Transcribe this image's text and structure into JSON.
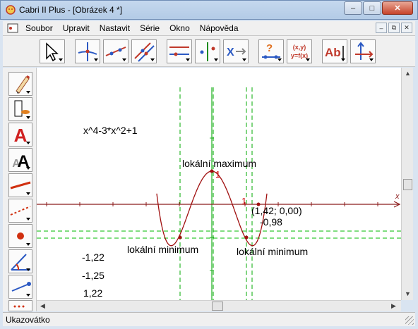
{
  "window": {
    "title": "Cabri II Plus - [Obrázek 4 *]"
  },
  "menu": [
    "Soubor",
    "Upravit",
    "Nastavit",
    "Série",
    "Okno",
    "Nápověda"
  ],
  "toolbar": {
    "tools": [
      "pointer-tool",
      "points-tool",
      "lines-tool",
      "curves-tool",
      "constructions-tool",
      "transformations-tool",
      "macro-tool",
      "check-property-tool",
      "measure-tool",
      "display-tool",
      "attributes-tool"
    ],
    "calc_label": "(x,y)\ny=f(x)",
    "text_tool_label": "Ab"
  },
  "left_tools": [
    "pencil-tool",
    "modify-appearance-tool",
    "color-text-tool",
    "font-tool",
    "thickness-tool",
    "dotted-line-tool",
    "point-style-tool",
    "angle-mark-tool",
    "vector-tool",
    "grid-tool"
  ],
  "canvas": {
    "equation": "x^4-3*x^2+1",
    "label_max": "lokální maximum",
    "label_min_left": "lokální minimum",
    "label_min_right": "lokální minimum",
    "point_coords": "(1,42; 0,00)",
    "value_y_min": "-0,98",
    "values": [
      "-1,22",
      "-1,25",
      "1,22"
    ],
    "marker_1_top": "1",
    "marker_1_axis": "1",
    "axis_x_label": "x",
    "curve_color": "#a01010",
    "axis_color": "#8b1a1a",
    "guide_color_v": "#00aa00",
    "guide_color_h": "#00bb00"
  },
  "status": {
    "text": "Ukazovátko"
  }
}
